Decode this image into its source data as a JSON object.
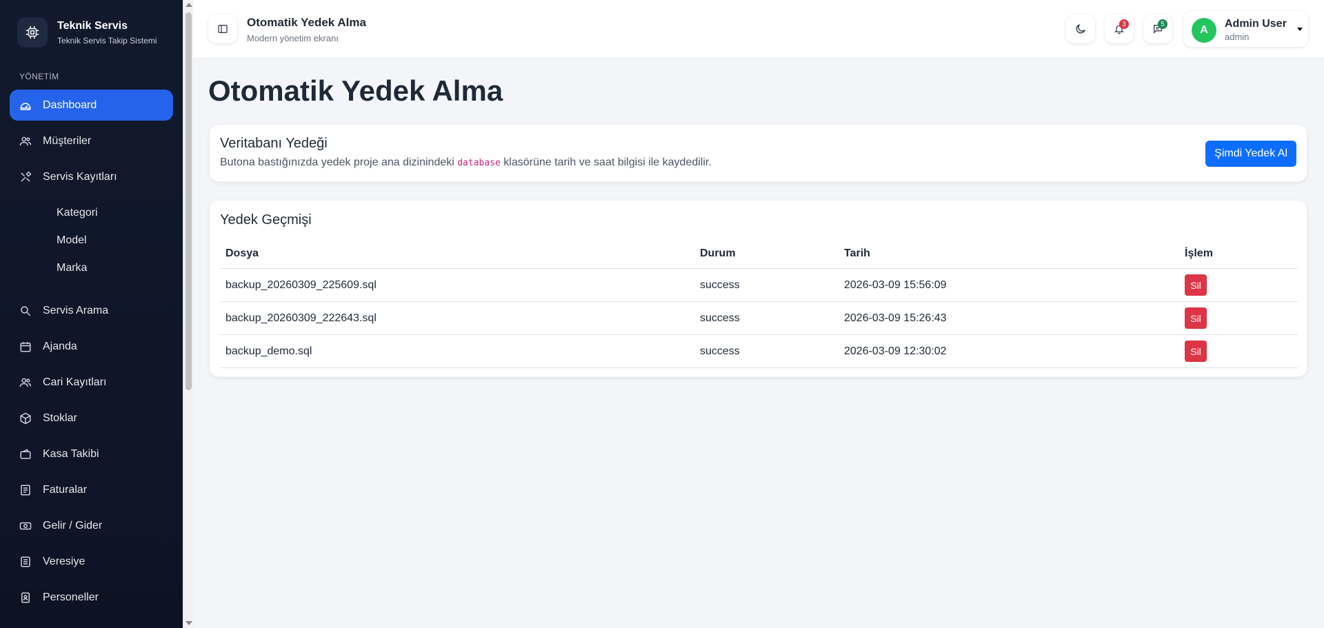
{
  "brand": {
    "title": "Teknik Servis",
    "subtitle": "Teknik Servis Takip Sistemi"
  },
  "sidebar": {
    "section_label": "YÖNETİM",
    "items": [
      {
        "label": "Dashboard",
        "icon": "dashboard-icon",
        "active": true
      },
      {
        "label": "Müşteriler",
        "icon": "users-icon"
      },
      {
        "label": "Servis Kayıtları",
        "icon": "tools-icon"
      },
      {
        "label": "Servis Arama",
        "icon": "search-icon"
      },
      {
        "label": "Ajanda",
        "icon": "calendar-icon"
      },
      {
        "label": "Cari Kayıtları",
        "icon": "users-icon"
      },
      {
        "label": "Stoklar",
        "icon": "box-icon"
      },
      {
        "label": "Kasa Takibi",
        "icon": "wallet-icon"
      },
      {
        "label": "Faturalar",
        "icon": "invoice-icon"
      },
      {
        "label": "Gelir / Gider",
        "icon": "cash-icon"
      },
      {
        "label": "Veresiye",
        "icon": "ledger-icon"
      },
      {
        "label": "Personeller",
        "icon": "badge-icon"
      }
    ],
    "sub_items": [
      "Kategori",
      "Model",
      "Marka"
    ]
  },
  "header": {
    "title": "Otomatik Yedek Alma",
    "subtitle": "Modern yönetim ekranı",
    "notifications": "3",
    "messages": "5",
    "user": {
      "initial": "A",
      "name": "Admin User",
      "role": "admin"
    }
  },
  "page": {
    "title": "Otomatik Yedek Alma",
    "backup_card": {
      "title": "Veritabanı Yedeği",
      "desc_before": "Butona bastığınızda yedek proje ana dizinindeki ",
      "desc_code": "database",
      "desc_after": " klasörüne tarih ve saat bilgisi ile kaydedilir.",
      "button": "Şimdi Yedek Al"
    },
    "history": {
      "title": "Yedek Geçmişi",
      "columns": [
        "Dosya",
        "Durum",
        "Tarih",
        "İşlem"
      ],
      "rows": [
        {
          "file": "backup_20260309_225609.sql",
          "status": "success",
          "date": "2026-03-09 15:56:09",
          "action": "Sil"
        },
        {
          "file": "backup_20260309_222643.sql",
          "status": "success",
          "date": "2026-03-09 15:26:43",
          "action": "Sil"
        },
        {
          "file": "backup_demo.sql",
          "status": "success",
          "date": "2026-03-09 12:30:02",
          "action": "Sil"
        }
      ]
    }
  },
  "colors": {
    "accent": "#2563eb",
    "primary_button": "#0d6efd",
    "danger": "#dc3545",
    "sidebar_bg": "#111a2c",
    "avatar": "#22c55e"
  }
}
